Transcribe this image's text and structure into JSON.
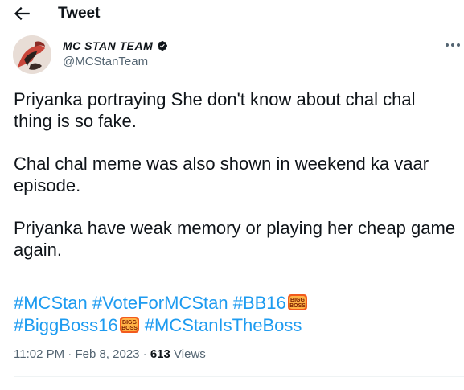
{
  "header": {
    "title": "Tweet",
    "back_icon": "arrow-left-icon"
  },
  "author": {
    "name": "MC STAN TEAM",
    "handle": "@MCStanTeam",
    "verified_icon": "verified-badge-icon",
    "avatar_icon": "avatar-image"
  },
  "tweet": {
    "paragraphs": [
      "Priyanka portraying She don't know about chal chal thing is so fake.",
      "Chal chal meme was also shown in weekend ka vaar episode.",
      "Priyanka have weak memory or playing her cheap game again."
    ],
    "hashtags": [
      "#MCStan",
      "#VoteForMCStan",
      "#BB16",
      "#BiggBoss16",
      "#MCStanIsTheBoss"
    ],
    "badge_text": [
      "BIGG",
      "BOSS"
    ]
  },
  "meta": {
    "time": "11:02 PM",
    "separator": "·",
    "date": "Feb 8, 2023",
    "views_count": "613",
    "views_label": "Views"
  },
  "colors": {
    "link": "#1d9bf0",
    "secondary": "#536471",
    "text": "#0f1419"
  }
}
